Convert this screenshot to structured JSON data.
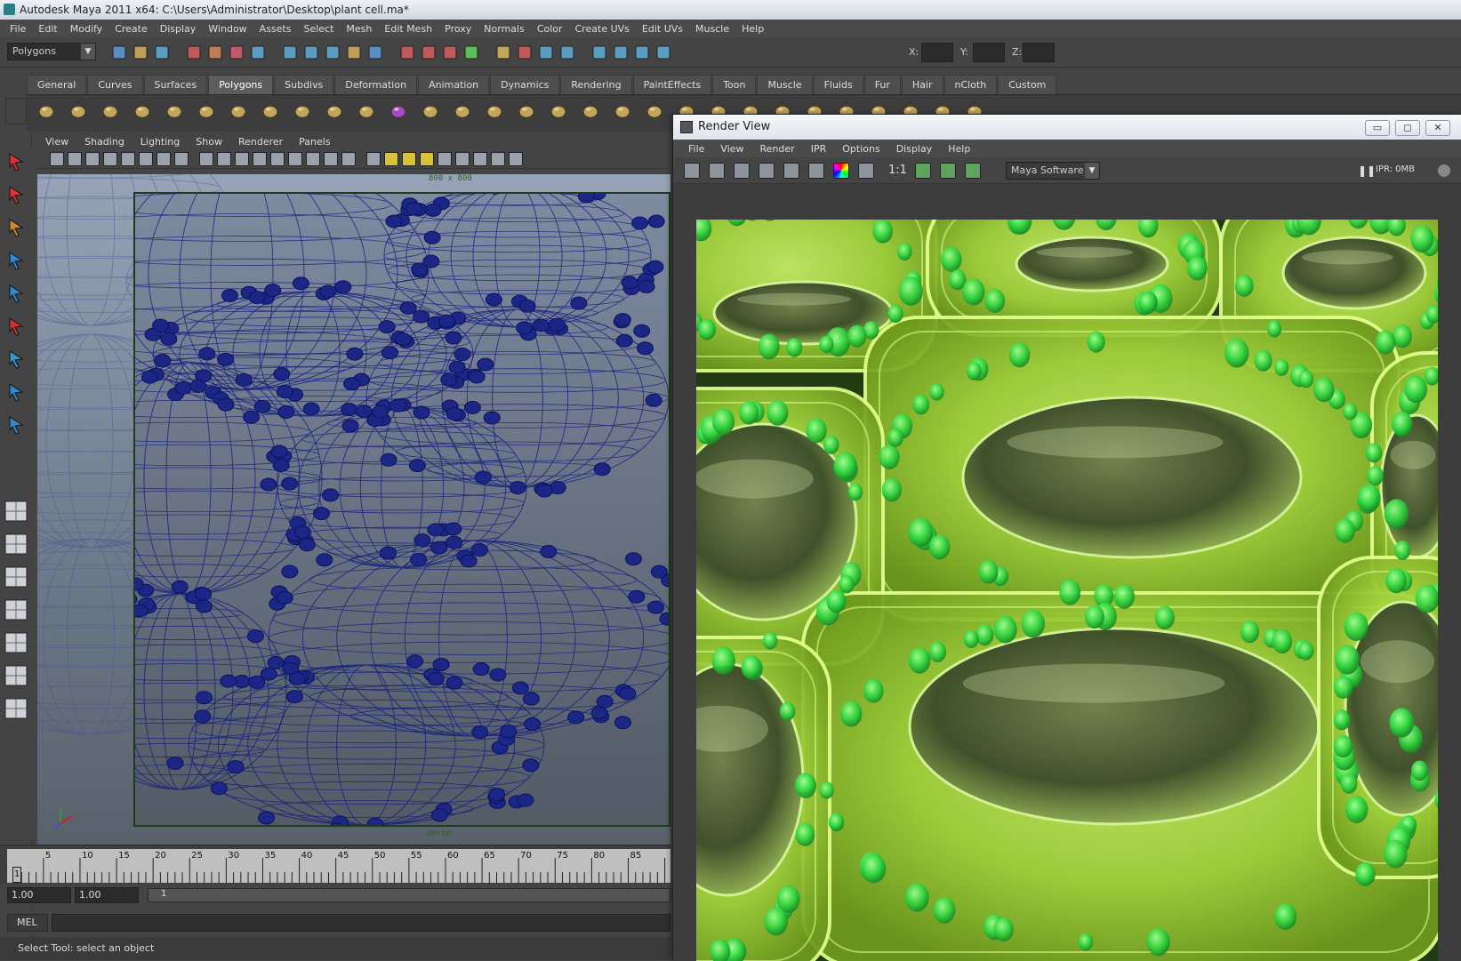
{
  "app": {
    "title": "Autodesk Maya 2011 x64: C:\\Users\\Administrator\\Desktop\\plant cell.ma*"
  },
  "menus": [
    "File",
    "Edit",
    "Modify",
    "Create",
    "Display",
    "Window",
    "Assets",
    "Select",
    "Mesh",
    "Edit Mesh",
    "Proxy",
    "Normals",
    "Color",
    "Create UVs",
    "Edit UVs",
    "Muscle",
    "Help"
  ],
  "statusline": {
    "menu_set": "Polygons",
    "x_label": "X:",
    "y_label": "Y:",
    "z_label": "Z:"
  },
  "shelf": {
    "tabs": [
      "General",
      "Curves",
      "Surfaces",
      "Polygons",
      "Subdivs",
      "Deformation",
      "Animation",
      "Dynamics",
      "Rendering",
      "PaintEffects",
      "Toon",
      "Muscle",
      "Fluids",
      "Fur",
      "Hair",
      "nCloth",
      "Custom"
    ],
    "active_tab": "Polygons"
  },
  "viewport": {
    "menus": [
      "View",
      "Shading",
      "Lighting",
      "Show",
      "Renderer",
      "Panels"
    ],
    "resolution_label": "800 x 800",
    "camera_label": "persp"
  },
  "timeline": {
    "ticks": [
      "5",
      "10",
      "15",
      "20",
      "25",
      "30",
      "35",
      "40",
      "45",
      "50",
      "55",
      "60",
      "65",
      "70",
      "75",
      "80",
      "85"
    ],
    "current_frame": "1",
    "range_start": "1.00",
    "range_start2": "1.00",
    "range_field": "1"
  },
  "command_line": {
    "label": "MEL"
  },
  "help_line": {
    "text": "Select Tool: select an object"
  },
  "render_view": {
    "title": "Render View",
    "menus": [
      "File",
      "View",
      "Render",
      "IPR",
      "Options",
      "Display",
      "Help"
    ],
    "ratio_label": "1:1",
    "renderer": "Maya Software",
    "ipr_status": "IPR: 0MB",
    "window_buttons": [
      "minimize",
      "maximize",
      "close"
    ]
  },
  "colors": {
    "wire_blue": "#121a78",
    "cell_green": "#9fd23a",
    "chloroplast_green": "#3fe04a",
    "maya_gray": "#444444"
  }
}
